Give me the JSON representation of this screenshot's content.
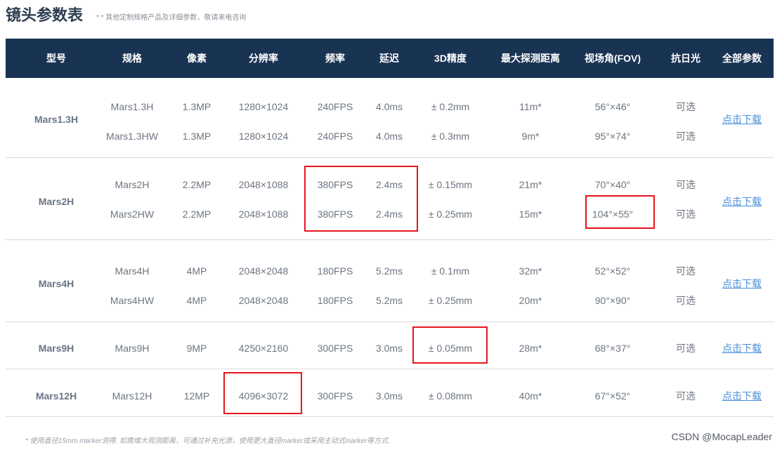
{
  "title": "镜头参数表",
  "subtitle": "* * 其他定制规格产品及详细参数，敬请来电咨询",
  "columns": [
    "型号",
    "规格",
    "像素",
    "分辨率",
    "频率",
    "延迟",
    "3D精度",
    "最大探测距离",
    "视场角(FOV)",
    "抗日光",
    "全部参数"
  ],
  "groups": [
    {
      "model": "Mars1.3H",
      "download": "点击下载",
      "rows": [
        {
          "spec": "Mars1.3H",
          "pixels": "1.3MP",
          "resolution": "1280×1024",
          "fps": "240FPS",
          "latency": "4.0ms",
          "accuracy": "± 0.2mm",
          "range": "11m*",
          "fov": "56°×46°",
          "sunlight": "可选"
        },
        {
          "spec": "Mars1.3HW",
          "pixels": "1.3MP",
          "resolution": "1280×1024",
          "fps": "240FPS",
          "latency": "4.0ms",
          "accuracy": "± 0.3mm",
          "range": "9m*",
          "fov": "95°×74°",
          "sunlight": "可选"
        }
      ]
    },
    {
      "model": "Mars2H",
      "download": "点击下载",
      "rows": [
        {
          "spec": "Mars2H",
          "pixels": "2.2MP",
          "resolution": "2048×1088",
          "fps": "380FPS",
          "latency": "2.4ms",
          "accuracy": "± 0.15mm",
          "range": "21m*",
          "fov": "70°×40°",
          "sunlight": "可选"
        },
        {
          "spec": "Mars2HW",
          "pixels": "2.2MP",
          "resolution": "2048×1088",
          "fps": "380FPS",
          "latency": "2.4ms",
          "accuracy": "± 0.25mm",
          "range": "15m*",
          "fov": "104°×55°",
          "sunlight": "可选"
        }
      ]
    },
    {
      "model": "Mars4H",
      "download": "点击下载",
      "rows": [
        {
          "spec": "Mars4H",
          "pixels": "4MP",
          "resolution": "2048×2048",
          "fps": "180FPS",
          "latency": "5.2ms",
          "accuracy": "± 0.1mm",
          "range": "32m*",
          "fov": "52°×52°",
          "sunlight": "可选"
        },
        {
          "spec": "Mars4HW",
          "pixels": "4MP",
          "resolution": "2048×2048",
          "fps": "180FPS",
          "latency": "5.2ms",
          "accuracy": "± 0.25mm",
          "range": "20m*",
          "fov": "90°×90°",
          "sunlight": "可选"
        }
      ]
    },
    {
      "model": "Mars9H",
      "download": "点击下载",
      "rows": [
        {
          "spec": "Mars9H",
          "pixels": "9MP",
          "resolution": "4250×2160",
          "fps": "300FPS",
          "latency": "3.0ms",
          "accuracy": "± 0.05mm",
          "range": "28m*",
          "fov": "68°×37°",
          "sunlight": "可选"
        }
      ]
    },
    {
      "model": "Mars12H",
      "download": "点击下载",
      "rows": [
        {
          "spec": "Mars12H",
          "pixels": "12MP",
          "resolution": "4096×3072",
          "fps": "300FPS",
          "latency": "3.0ms",
          "accuracy": "± 0.08mm",
          "range": "40m*",
          "fov": "67°×52°",
          "sunlight": "可选"
        }
      ]
    }
  ],
  "footnote": "* 使用直径15mm marker测得. 如需增大观测距离，可通过补充光源，使用更大直径marker或采用主动式marker等方式.",
  "watermark": "CSDN @MocapLeader",
  "highlight_color": "#e8141c"
}
